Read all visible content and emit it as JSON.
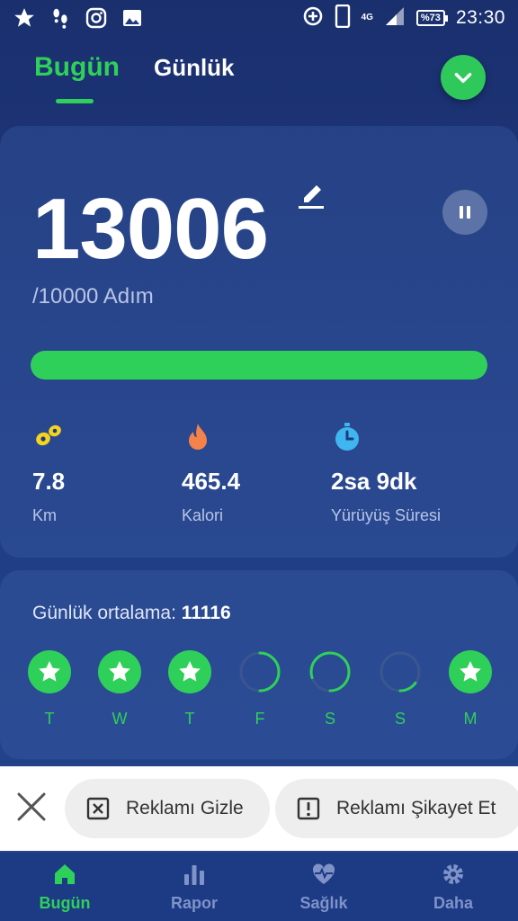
{
  "status_bar": {
    "network": "4G",
    "battery": "%73",
    "time": "23:30"
  },
  "tabs": [
    {
      "label": "Bugün",
      "active": true
    },
    {
      "label": "Günlük",
      "active": false
    }
  ],
  "steps": {
    "value": "13006",
    "goal_text": "/10000 Adım",
    "progress_fraction": 1.0
  },
  "stats": [
    {
      "value": "7.8",
      "label": "Km",
      "icon": "footprints-icon"
    },
    {
      "value": "465.4",
      "label": "Kalori",
      "icon": "flame-icon"
    },
    {
      "value": "2sa 9dk",
      "label": "Yürüyüş Süresi",
      "icon": "stopwatch-icon"
    }
  ],
  "daily_average": {
    "label": "Günlük ortalama:",
    "value": "11116"
  },
  "days": [
    {
      "label": "T",
      "status": "goal",
      "fraction": 1.0
    },
    {
      "label": "W",
      "status": "goal",
      "fraction": 1.0
    },
    {
      "label": "T",
      "status": "goal",
      "fraction": 1.0
    },
    {
      "label": "F",
      "status": "partial",
      "fraction": 0.5
    },
    {
      "label": "S",
      "status": "partial",
      "fraction": 0.8
    },
    {
      "label": "S",
      "status": "partial",
      "fraction": 0.15
    },
    {
      "label": "M",
      "status": "goal",
      "fraction": 1.0
    }
  ],
  "ad_bar": {
    "hide_label": "Reklamı Gizle",
    "report_label": "Reklamı Şikayet Et"
  },
  "bottom_nav": [
    {
      "label": "Bugün",
      "icon": "home-icon",
      "active": true
    },
    {
      "label": "Rapor",
      "icon": "bar-chart-icon",
      "active": false
    },
    {
      "label": "Sağlık",
      "icon": "heart-pulse-icon",
      "active": false
    },
    {
      "label": "Daha",
      "icon": "gear-icon",
      "active": false
    }
  ],
  "colors": {
    "accent": "#2fd05a",
    "background": "#1f3b80",
    "track": "#3b5590"
  }
}
